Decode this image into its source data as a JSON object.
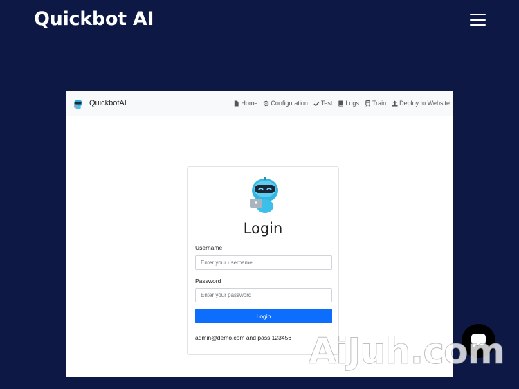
{
  "site": {
    "brand": "Quickbot AI",
    "menu_icon": "hamburger-menu-icon"
  },
  "app": {
    "name": "QuickbotAI",
    "logo_icon": "robot-logo-icon",
    "nav": [
      {
        "label": "Home",
        "icon": "file-icon"
      },
      {
        "label": "Configuration",
        "icon": "gear-icon"
      },
      {
        "label": "Test",
        "icon": "check-icon"
      },
      {
        "label": "Logs",
        "icon": "book-icon"
      },
      {
        "label": "Train",
        "icon": "train-icon"
      },
      {
        "label": "Deploy to Website",
        "icon": "upload-icon"
      }
    ]
  },
  "login": {
    "title": "Login",
    "username_label": "Username",
    "username_placeholder": "Enter your username",
    "password_label": "Password",
    "password_placeholder": "Enter your password",
    "button_label": "Login",
    "demo_credentials": "admin@demo.com and pass:123456"
  },
  "chat": {
    "icon": "chat-bubble-icon"
  },
  "watermark": "AiJuh.com",
  "colors": {
    "page_background": "#0d1845",
    "primary_button": "#0d6efd",
    "navbar_background": "#f8f9fa"
  }
}
